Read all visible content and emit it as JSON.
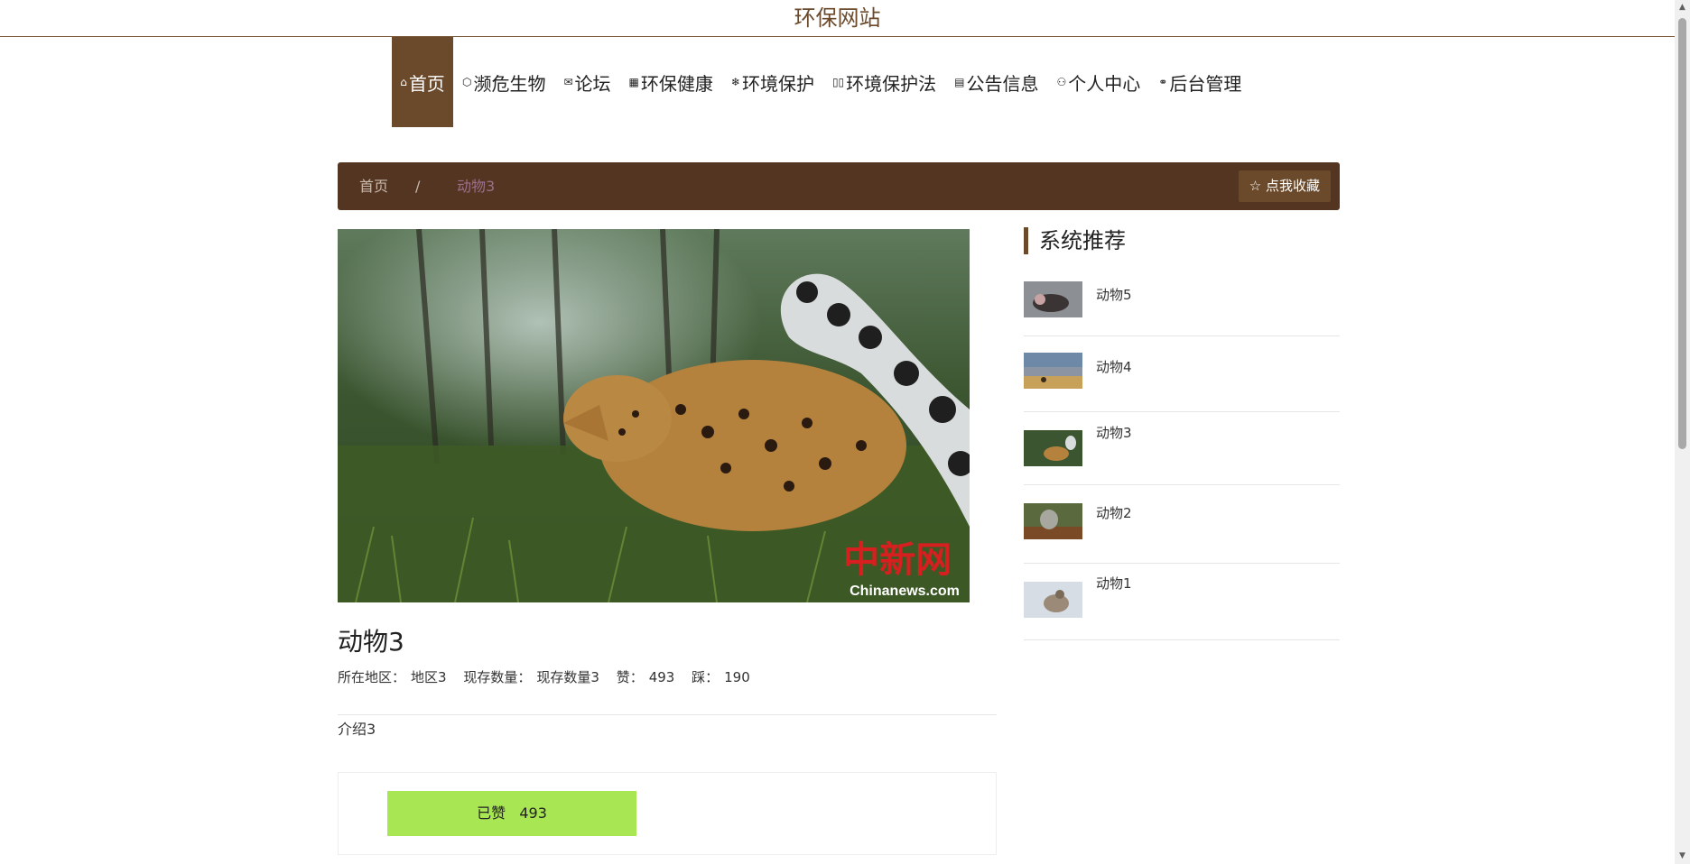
{
  "site": {
    "title": "环保网站"
  },
  "nav": {
    "items": [
      {
        "label": "首页",
        "icon": "home-icon",
        "glyph": "⌂",
        "active": true
      },
      {
        "label": "濒危生物",
        "icon": "cube-icon",
        "glyph": "⬡"
      },
      {
        "label": "论坛",
        "icon": "mail-icon",
        "glyph": "✉"
      },
      {
        "label": "环保健康",
        "icon": "gift-icon",
        "glyph": "▦"
      },
      {
        "label": "环境保护",
        "icon": "snowflake-icon",
        "glyph": "❄"
      },
      {
        "label": "环境保护法",
        "icon": "book-icon",
        "glyph": "▯▯"
      },
      {
        "label": "公告信息",
        "icon": "clipboard-icon",
        "glyph": "▤"
      },
      {
        "label": "个人中心",
        "icon": "user-icon",
        "glyph": "⚇"
      },
      {
        "label": "后台管理",
        "icon": "link-icon",
        "glyph": "⚭"
      }
    ]
  },
  "breadcrumb": {
    "home": "首页",
    "separator": "/",
    "current": "动物3"
  },
  "favorite": {
    "label": "点我收藏",
    "icon": "star-icon",
    "glyph": "☆"
  },
  "item": {
    "title": "动物3",
    "region_label": "所在地区：",
    "region": "地区3",
    "count_label": "现存数量：",
    "count": "现存数量3",
    "like_label": "赞：",
    "likes": "493",
    "dislike_label": "踩：",
    "dislikes": "190",
    "intro": "介绍3",
    "photo_watermark": "中新网",
    "photo_watermark_en": "Chinanews.com"
  },
  "like_button": {
    "label": "已赞",
    "count": "493"
  },
  "recommend": {
    "title": "系统推荐",
    "items": [
      {
        "label": "动物5"
      },
      {
        "label": "动物4"
      },
      {
        "label": "动物3"
      },
      {
        "label": "动物2"
      },
      {
        "label": "动物1"
      }
    ]
  },
  "colors": {
    "brand": "#6b4a2b",
    "breadcrumb_bg": "#543521",
    "like_green": "#a8e653"
  }
}
